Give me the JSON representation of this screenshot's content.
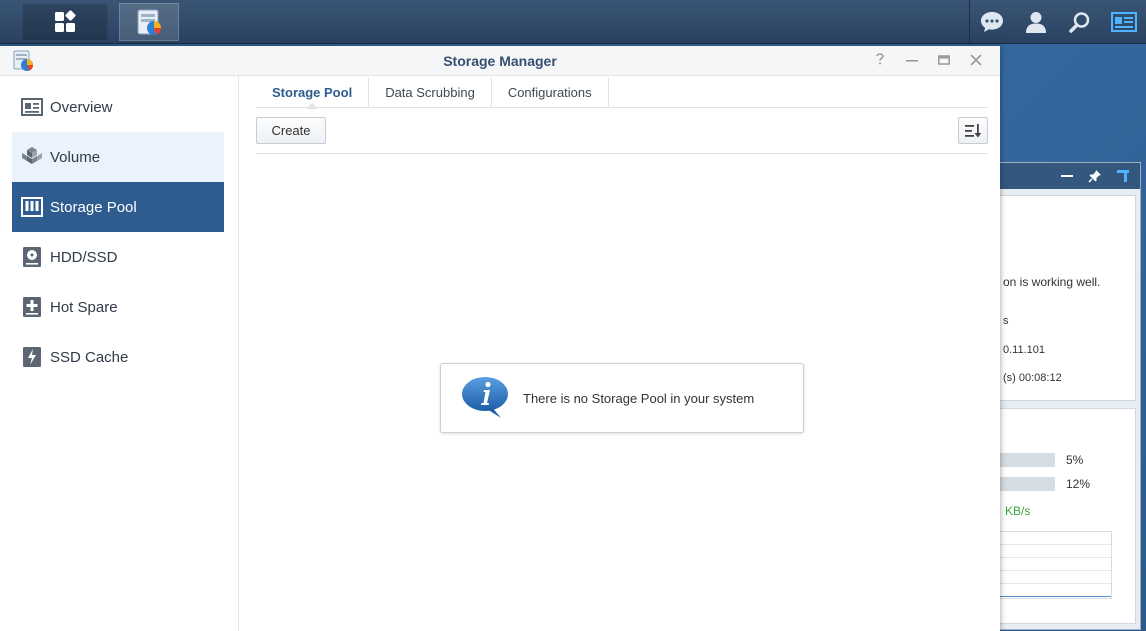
{
  "window": {
    "title": "Storage Manager"
  },
  "sidebar": {
    "items": [
      {
        "label": "Overview",
        "icon": "overview-icon"
      },
      {
        "label": "Volume",
        "icon": "volume-icon"
      },
      {
        "label": "Storage Pool",
        "icon": "storage-pool-icon"
      },
      {
        "label": "HDD/SSD",
        "icon": "hdd-icon"
      },
      {
        "label": "Hot Spare",
        "icon": "hot-spare-icon"
      },
      {
        "label": "SSD Cache",
        "icon": "ssd-cache-icon"
      }
    ]
  },
  "tabs": [
    {
      "label": "Storage Pool"
    },
    {
      "label": "Data Scrubbing"
    },
    {
      "label": "Configurations"
    }
  ],
  "toolbar": {
    "create_label": "Create"
  },
  "empty_state": {
    "message": "There is no Storage Pool in your system"
  },
  "widget": {
    "status_text": "on is working well.",
    "line2": "s",
    "ip_text": "0.11.101",
    "uptime_text": "(s) 00:08:12",
    "cpu_percent": "5%",
    "ram_percent": "12%",
    "network_rate": "KB/s"
  },
  "colors": {
    "accent": "#2e5c8f",
    "title": "#35506f",
    "network_green": "#3ca33c"
  }
}
